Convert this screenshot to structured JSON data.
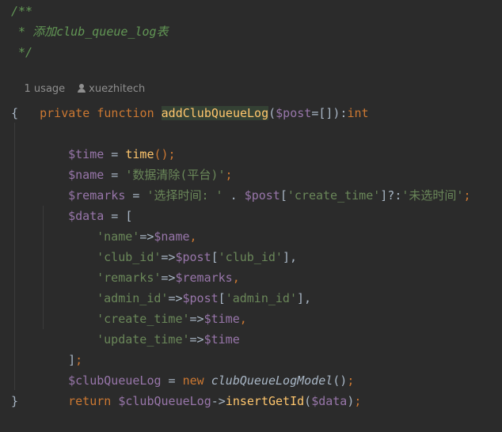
{
  "doc_comment": {
    "open": "/**",
    "star": " * ",
    "text_cn": "添加",
    "text_code": "club_queue_log",
    "text_tail": "表",
    "close": " */"
  },
  "inlay": {
    "usages": "1 usage",
    "author": "xuezhitech",
    "author_icon": "person-icon"
  },
  "code": {
    "signature": {
      "kw_private": "private",
      "kw_function": "function",
      "fn_name": "addClubQueueLog",
      "p_open": "(",
      "param": "$post",
      "param_default": "=[]",
      "p_close": "):",
      "return_type": "int"
    },
    "brace_open": "{",
    "brace_close": "}",
    "line_time": {
      "var": "$time",
      "op": " = ",
      "call": "time",
      "tail": "();"
    },
    "line_name": {
      "var": "$name",
      "op": " = ",
      "str": "'数据清除(平台)'",
      "tail": ";"
    },
    "line_remarks": {
      "var": "$remarks",
      "op": " = ",
      "str1": "'选择时间: '",
      "concat": " . ",
      "post": "$post",
      "b_open": "[",
      "key": "'create_time'",
      "b_close": "]?:",
      "str2": "'未选时间'",
      "tail": ";"
    },
    "line_data_open": {
      "var": "$data",
      "op": " = ["
    },
    "array_items": [
      {
        "key": "'name'",
        "arrow": "=>",
        "val": "$name",
        "tail": ","
      },
      {
        "key": "'club_id'",
        "arrow": "=>",
        "val": "$post",
        "b_open": "[",
        "inner": "'club_id'",
        "b_close": "],",
        "tail": ""
      },
      {
        "key": "'remarks'",
        "arrow": "=>",
        "val": "$remarks",
        "tail": ","
      },
      {
        "key": "'admin_id'",
        "arrow": "=>",
        "val": "$post",
        "b_open": "[",
        "inner": "'admin_id'",
        "b_close": "],",
        "tail": ""
      },
      {
        "key": "'create_time'",
        "arrow": "=>",
        "val": "$time",
        "tail": ","
      },
      {
        "key": "'update_time'",
        "arrow": "=>",
        "val": "$time",
        "tail": ""
      }
    ],
    "line_data_close": "];",
    "line_new": {
      "var": "$clubQueueLog",
      "op": " = ",
      "kw_new": "new",
      "cls": "clubQueueLogModel",
      "tail": "();"
    },
    "line_return": {
      "kw_return": "return",
      "var": "$clubQueueLog",
      "arrow": "->",
      "call": "insertGetId",
      "p_open": "(",
      "arg": "$data",
      "p_close": ");"
    }
  },
  "colors": {
    "background": "#2b2b2b",
    "keyword": "#cc7832",
    "function": "#ffc66d",
    "variable": "#9876aa",
    "string": "#6a8759",
    "doc_comment": "#629755",
    "plain": "#a9b7c6",
    "inlay_hint": "#8f8f8f"
  }
}
